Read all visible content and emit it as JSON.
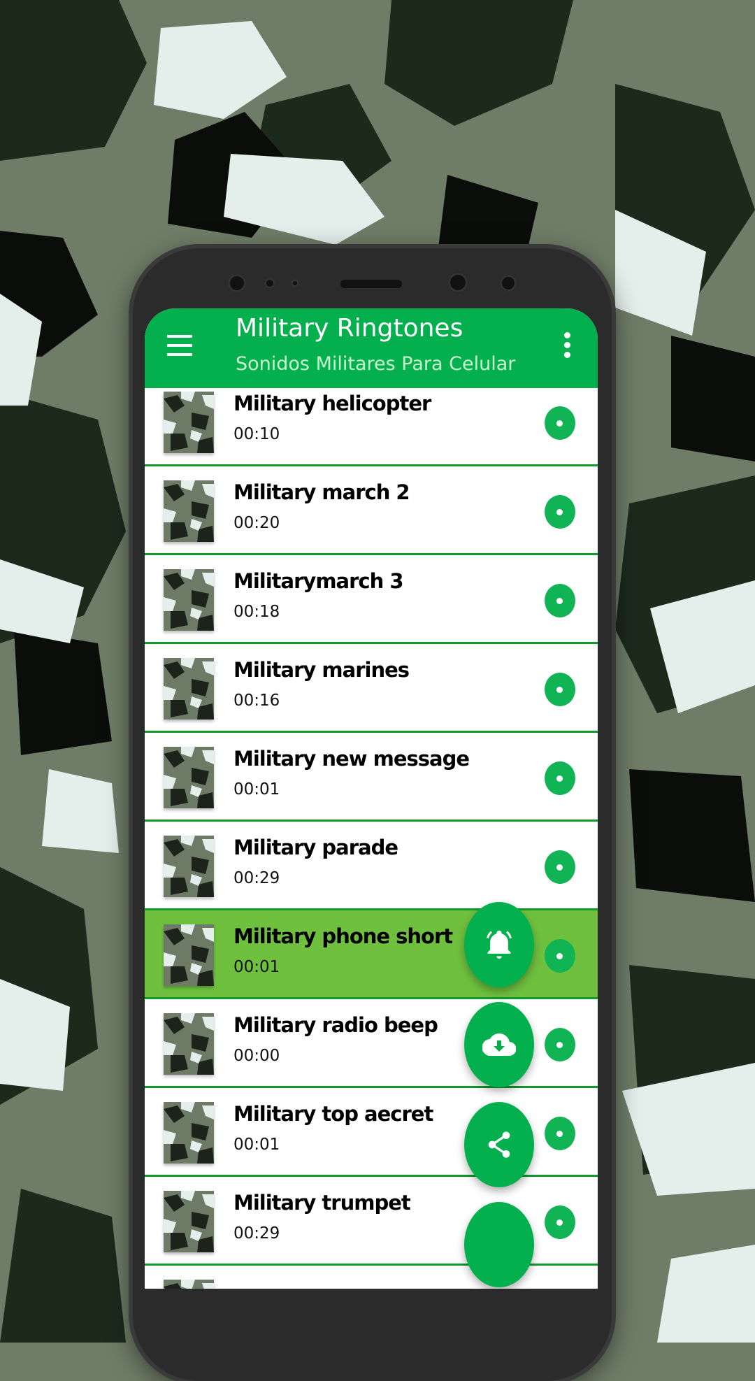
{
  "app": {
    "title": "Military Ringtones",
    "subtitle": "Sonidos Militares Para Celular"
  },
  "colors": {
    "primary": "#03b04d",
    "selected_row": "#6fc03f",
    "divider": "#129a2b"
  },
  "ringtones": [
    {
      "name": "Military helicopter",
      "duration": "00:10"
    },
    {
      "name": "Military march 2",
      "duration": "00:20"
    },
    {
      "name": "Militarymarch 3",
      "duration": "00:18"
    },
    {
      "name": "Military marines",
      "duration": "00:16"
    },
    {
      "name": "Military new message",
      "duration": "00:01"
    },
    {
      "name": "Military parade",
      "duration": "00:29"
    },
    {
      "name": "Military phone short",
      "duration": "00:01",
      "selected": true
    },
    {
      "name": "Military radio beep",
      "duration": "00:00"
    },
    {
      "name": "Military top aecret",
      "duration": "00:01"
    },
    {
      "name": "Military trumpet",
      "duration": "00:29"
    }
  ],
  "fab_actions": [
    {
      "icon": "bell-icon"
    },
    {
      "icon": "cloud-download-icon"
    },
    {
      "icon": "share-icon"
    },
    {
      "icon": "fab-main"
    }
  ]
}
